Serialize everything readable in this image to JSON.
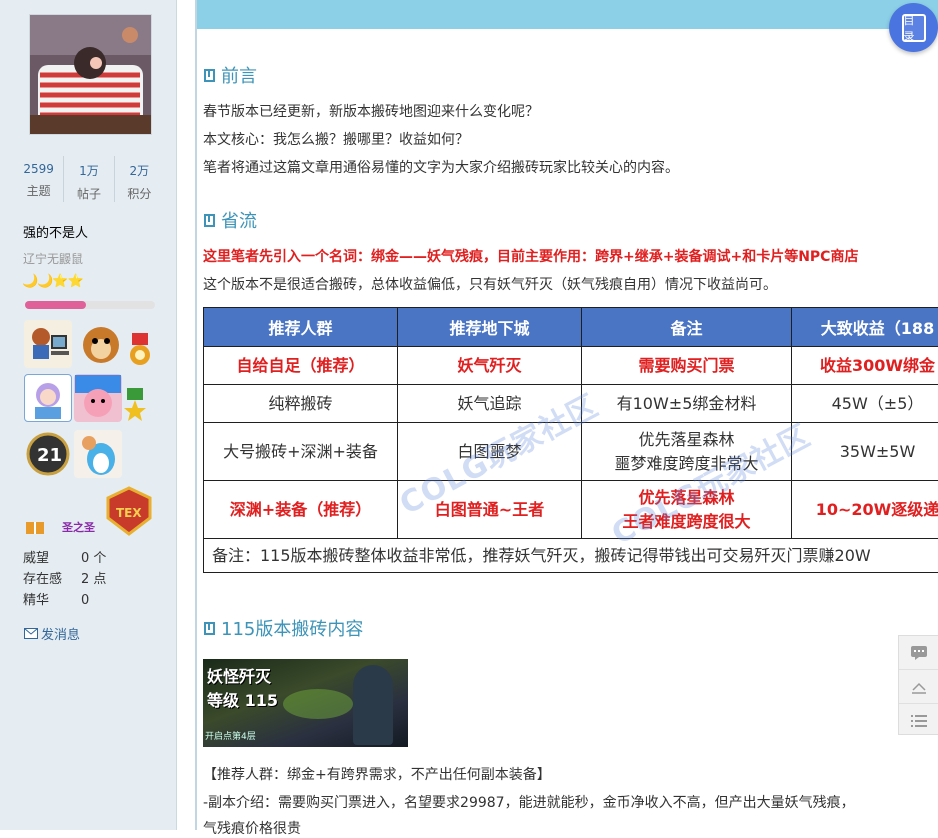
{
  "sidebar": {
    "stats": [
      {
        "value": "2599",
        "label": "主题"
      },
      {
        "value": "1万",
        "label": "帖子"
      },
      {
        "value": "2万",
        "label": "积分"
      }
    ],
    "user_title": "强的不是人",
    "user_group": "辽宁无鼹鼠",
    "level_icons": "🌙🌙⭐⭐",
    "level_progress": 0.47,
    "rank_badge_text": "圣之圣",
    "meta": [
      {
        "label": "威望",
        "value": "0 个"
      },
      {
        "label": "存在感",
        "value": "2 点"
      },
      {
        "label": "精华",
        "value": "0"
      }
    ],
    "send_message": "发消息"
  },
  "toc_button_label": "目录",
  "sections": {
    "preface_title": "前言",
    "preface_lines": [
      "春节版本已经更新，新版本搬砖地图迎来什么变化呢？",
      "本文核心：我怎么搬？搬哪里？收益如何？",
      "笔者将通过这篇文章用通俗易懂的文字为大家介绍搬砖玩家比较关心的内容。"
    ],
    "summary_title": "省流",
    "summary_red": "这里笔者先引入一个名词：绑金——妖气残痕，目前主要作用：跨界+继承+装备调试+和卡片等NPC商店",
    "summary_text": "这个版本不是很适合搬砖，总体收益偏低，只有妖气歼灭（妖气残痕自用）情况下收益尚可。",
    "content_title": "115版本搬砖内容",
    "content_lines": [
      "【推荐人群：绑金+有跨界需求，不产出任何副本装备】",
      "-副本介绍：需要购买门票进入，名望要求29987，能进就能秒，金币净收入不高，但产出大量妖气残痕，",
      "气残痕价格很贵"
    ]
  },
  "table": {
    "headers": [
      "推荐人群",
      "推荐地下城",
      "备注",
      "大致收益（188"
    ],
    "rows": [
      [
        "自给自足（推荐）",
        "妖气歼灭",
        "需要购买门票",
        "收益300W绑金"
      ],
      [
        "纯粹搬砖",
        "妖气追踪",
        "有10W±5绑金材料",
        "45W（±5）"
      ],
      [
        "大号搬砖+深渊+装备",
        "白图噩梦",
        "优先落星森林\n噩梦难度跨度非常大",
        "35W±5W"
      ],
      [
        "深渊+装备（推荐）",
        "白图普通~王者",
        "优先落星森林\n王者难度跨度很大",
        "10~20W逐级递"
      ]
    ],
    "note": "备注：115版本搬砖整体收益非常低，推荐妖气歼灭，搬砖记得带钱出可交易歼灭门票赚20W"
  },
  "watermark": "COLG玩家社区",
  "dungeon_image": {
    "line1": "妖怪歼灭",
    "line2": "等级 115",
    "line3": "开启点第4层"
  },
  "float_bar": [
    "comment-icon",
    "back-to-top-icon",
    "list-icon"
  ]
}
